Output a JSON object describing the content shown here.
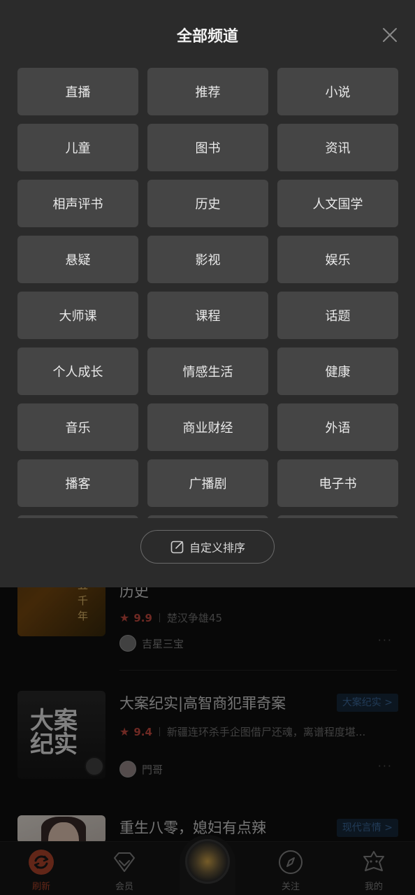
{
  "sheet": {
    "title": "全部频道",
    "close_icon": "close-icon",
    "channels": [
      "直播",
      "推荐",
      "小说",
      "儿童",
      "图书",
      "资讯",
      "相声评书",
      "历史",
      "人文国学",
      "悬疑",
      "影视",
      "娱乐",
      "大师课",
      "课程",
      "话题",
      "个人成长",
      "情感生活",
      "健康",
      "音乐",
      "商业财经",
      "外语",
      "播客",
      "广播剧",
      "电子书",
      "",
      "",
      ""
    ],
    "custom_sort_label": "自定义排序",
    "custom_sort_icon": "edit-icon"
  },
  "feed": {
    "items": [
      {
        "title": "历史",
        "cover_text": "下五千年",
        "rating": "9.9",
        "desc": "楚汉争雄45",
        "author": "吉星三宝",
        "more": "···"
      },
      {
        "title": "大案纪实|高智商犯罪奇案",
        "cover_text": "大案纪实",
        "rating": "9.4",
        "desc": "新疆连环杀手企图借尸还魂，离谱程度堪...",
        "author": "門哥",
        "tag": "大案纪实 >",
        "more": "···"
      },
      {
        "title": "重生八零，媳妇有点辣",
        "tag": "现代言情 >"
      }
    ]
  },
  "tabbar": {
    "tabs": [
      {
        "label": "刷新",
        "icon": "refresh-icon",
        "active": true
      },
      {
        "label": "会员",
        "icon": "diamond-icon",
        "active": false
      },
      {
        "label": "",
        "icon": "play-disc-icon",
        "active": false
      },
      {
        "label": "关注",
        "icon": "compass-icon",
        "active": false
      },
      {
        "label": "我的",
        "icon": "profile-icon",
        "active": false
      }
    ]
  },
  "colors": {
    "accent": "#b2462d",
    "sheet_bg": "#2b2b2b",
    "tile_bg": "#454545",
    "rating": "#c94b40",
    "tag_text": "#3d6c9e"
  }
}
